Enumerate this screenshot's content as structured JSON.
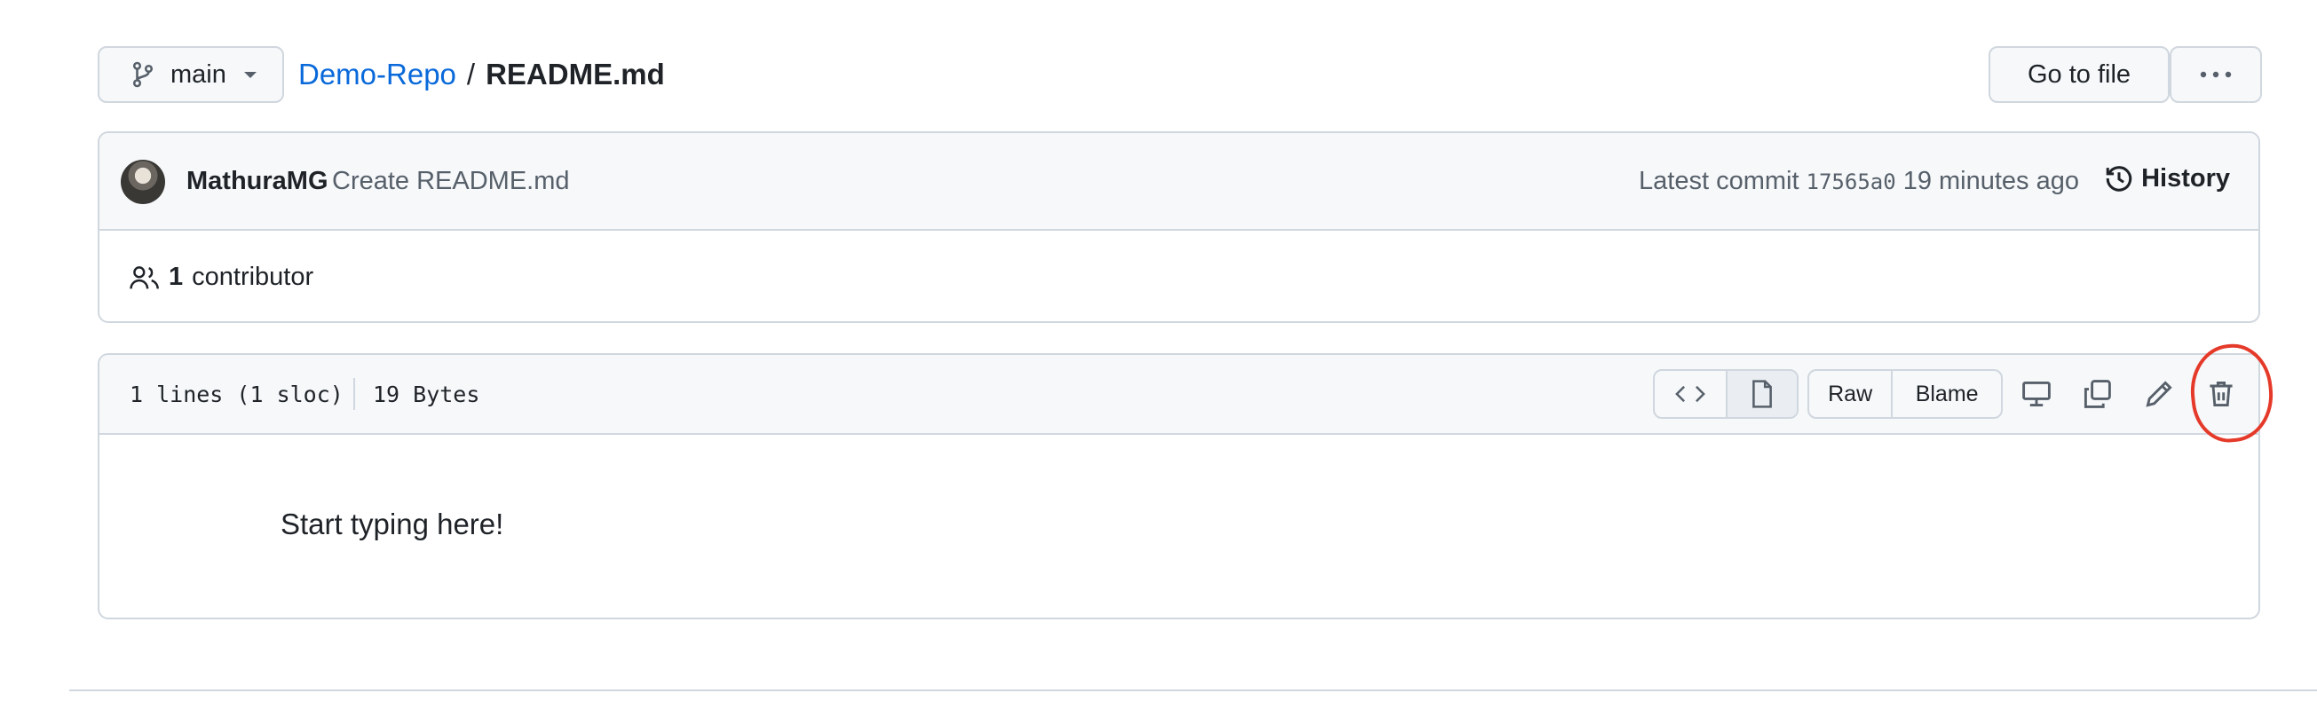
{
  "branch": {
    "name": "main",
    "icon": "git-branch-icon"
  },
  "breadcrumb": {
    "repo": "Demo-Repo",
    "separator": "/",
    "file": "README.md"
  },
  "actions": {
    "go_to_file": "Go to file",
    "more_icon": "kebab-horizontal-icon"
  },
  "commit": {
    "author": "MathuraMG",
    "message": "Create README.md",
    "latest_label": "Latest commit",
    "sha": "17565a0",
    "time": "19 minutes ago",
    "history_label": "History"
  },
  "contributors": {
    "count": "1",
    "label": "contributor"
  },
  "file_header": {
    "lines": "1 lines (1 sloc)",
    "size": "19 Bytes",
    "raw_label": "Raw",
    "blame_label": "Blame"
  },
  "file_content": {
    "text": "Start typing here!"
  },
  "colors": {
    "link": "#0969da",
    "border": "#d0d7de",
    "header_bg": "#f6f8fa",
    "annotation": "#e53a2a"
  }
}
